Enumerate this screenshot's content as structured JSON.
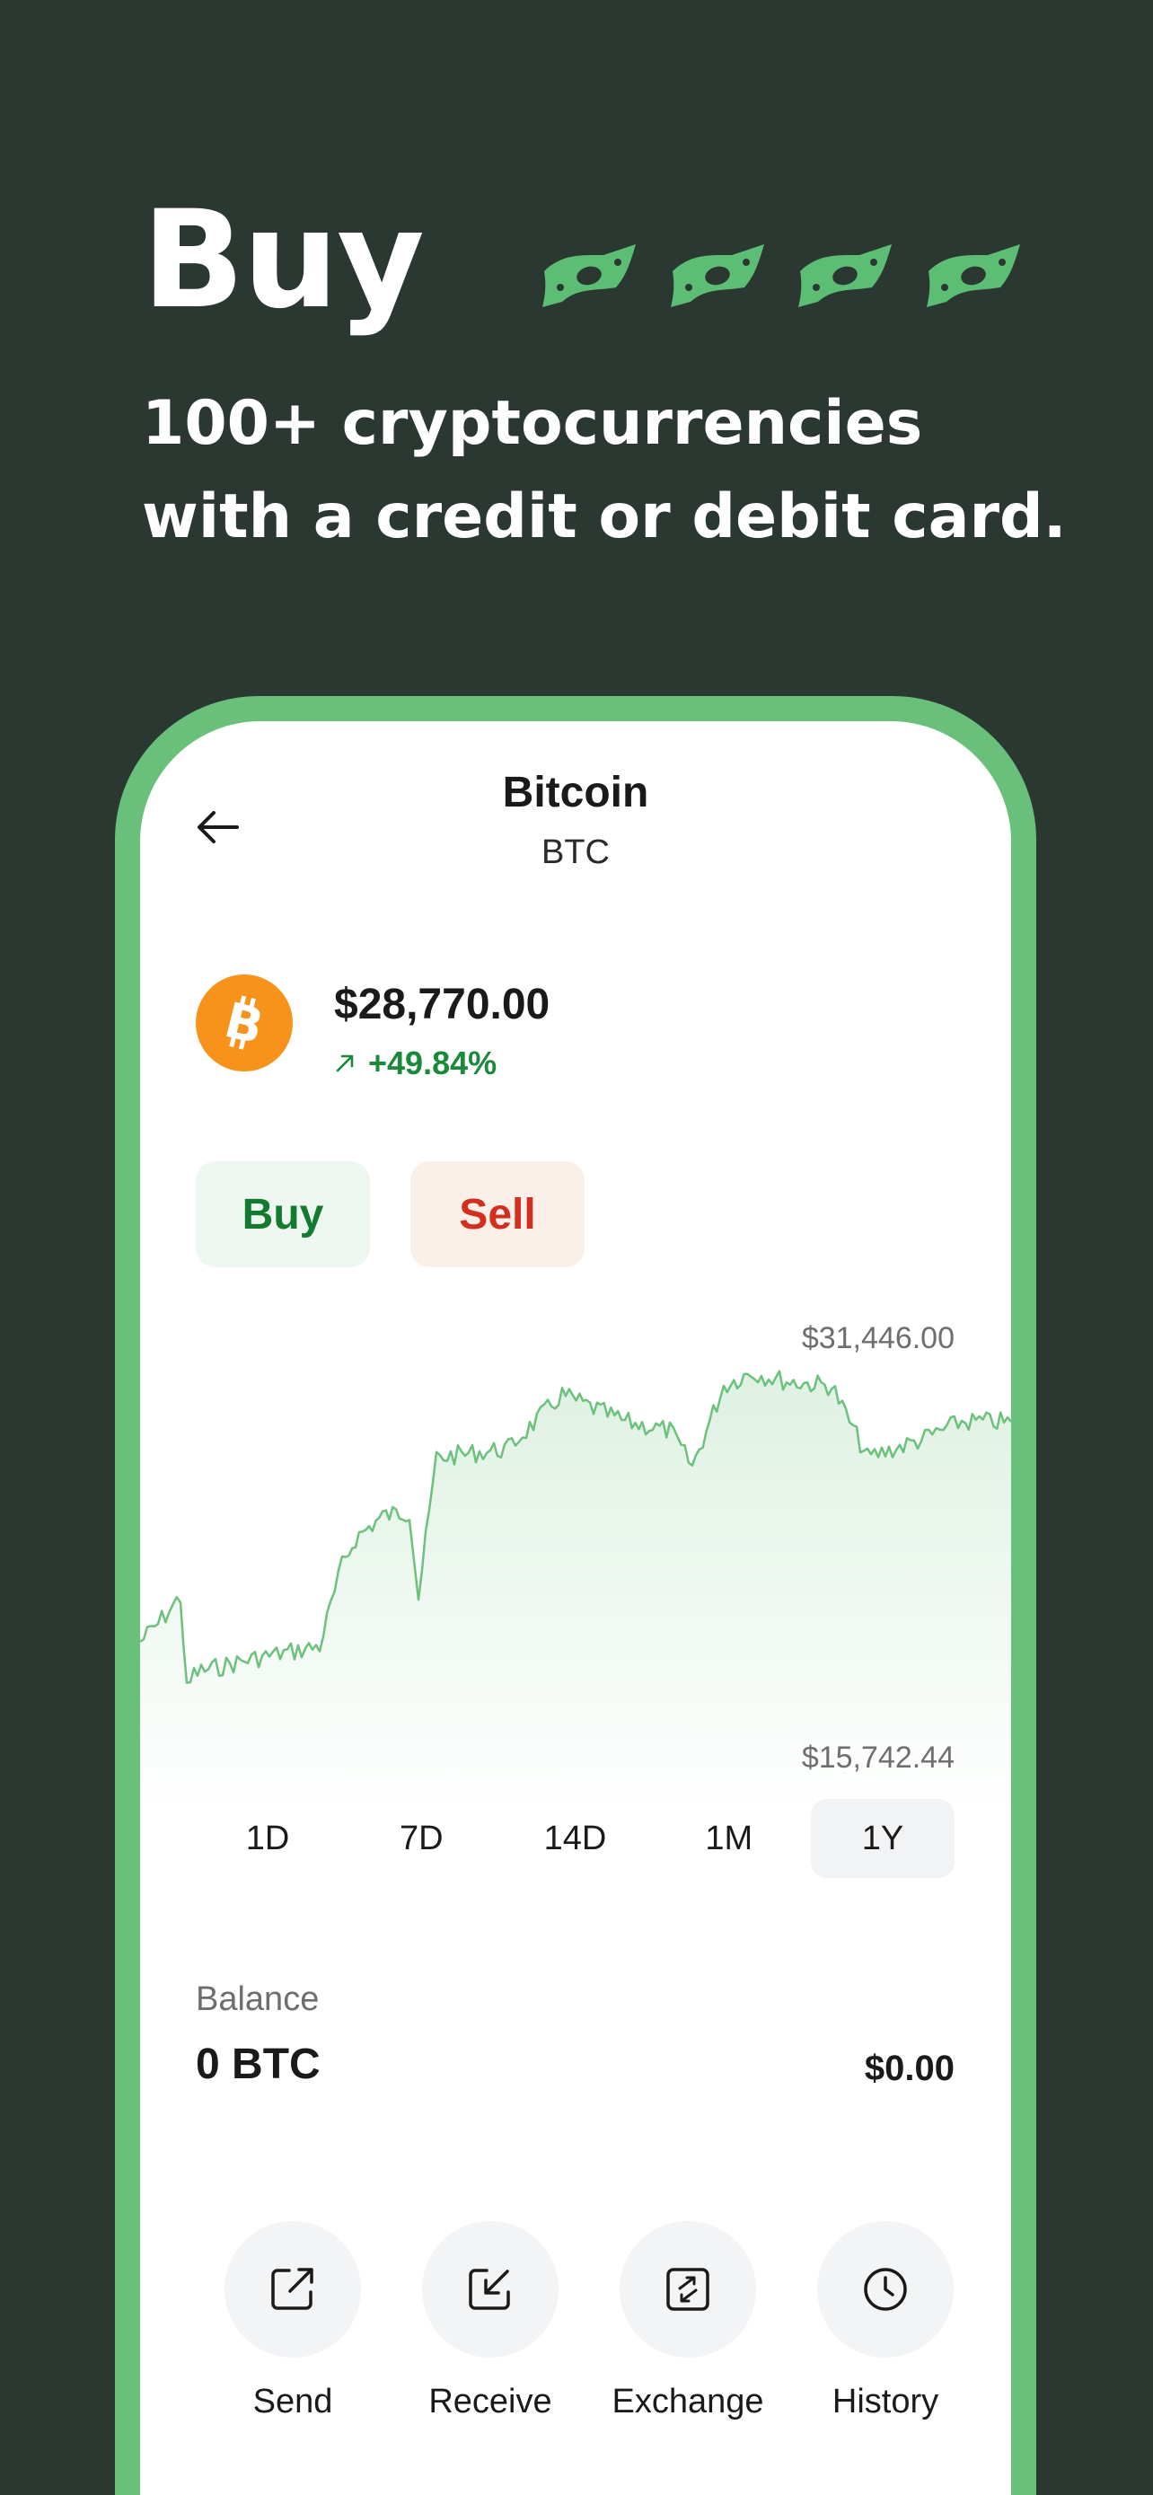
{
  "hero": {
    "title": "Buy",
    "subtitle_line1": "100+ cryptocurrencies",
    "subtitle_line2": "with a credit or debit card."
  },
  "header": {
    "coin_name": "Bitcoin",
    "ticker": "BTC"
  },
  "asset": {
    "price": "$28,770.00",
    "change": "+49.84%"
  },
  "trade": {
    "buy_label": "Buy",
    "sell_label": "Sell"
  },
  "chart": {
    "max_label": "$31,446.00",
    "min_label": "$15,742.44"
  },
  "periods": [
    "1D",
    "7D",
    "14D",
    "1M",
    "1Y"
  ],
  "active_period": "1Y",
  "balance": {
    "label": "Balance",
    "amount": "0 BTC",
    "fiat": "$0.00"
  },
  "actions": {
    "send": "Send",
    "receive": "Receive",
    "exchange": "Exchange",
    "history": "History"
  },
  "colors": {
    "background": "#2b3731",
    "accent_green": "#69c07a",
    "buy_text": "#137b2f",
    "sell_text": "#d1301e",
    "btc_orange": "#f7931a"
  },
  "icons": [
    "cash-icon",
    "back-arrow-icon",
    "bitcoin-icon",
    "trend-up-icon",
    "send-icon",
    "receive-icon",
    "exchange-icon",
    "history-icon"
  ]
}
